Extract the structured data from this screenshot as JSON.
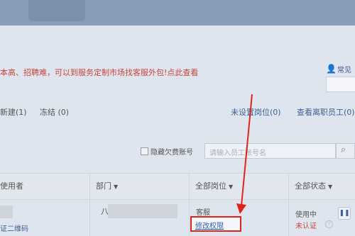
{
  "banner": {
    "message": "本高、招聘难，可以到服务定制市场找客服外包!",
    "link": "点此查看"
  },
  "help": {
    "label": "常见"
  },
  "filters": {
    "new": "新建(1)",
    "frozen": "冻结 (0)",
    "unassigned": "未设置岗位(0)",
    "resigned": "查看离职员工(0)"
  },
  "search": {
    "hide_label": "隐藏欠费账号",
    "placeholder": "请输入员工账号名"
  },
  "table": {
    "headers": [
      "使用者",
      "部门",
      "全部岗位",
      "全部状态"
    ],
    "row": {
      "user_link": "证二维码",
      "dept": "八",
      "position": "客服",
      "perm_link": "修改权限",
      "status_using": "使用中",
      "status_auth": "未认证"
    }
  },
  "colors": {
    "accent_red": "#e0241c",
    "link_blue": "#2f5fb3"
  }
}
